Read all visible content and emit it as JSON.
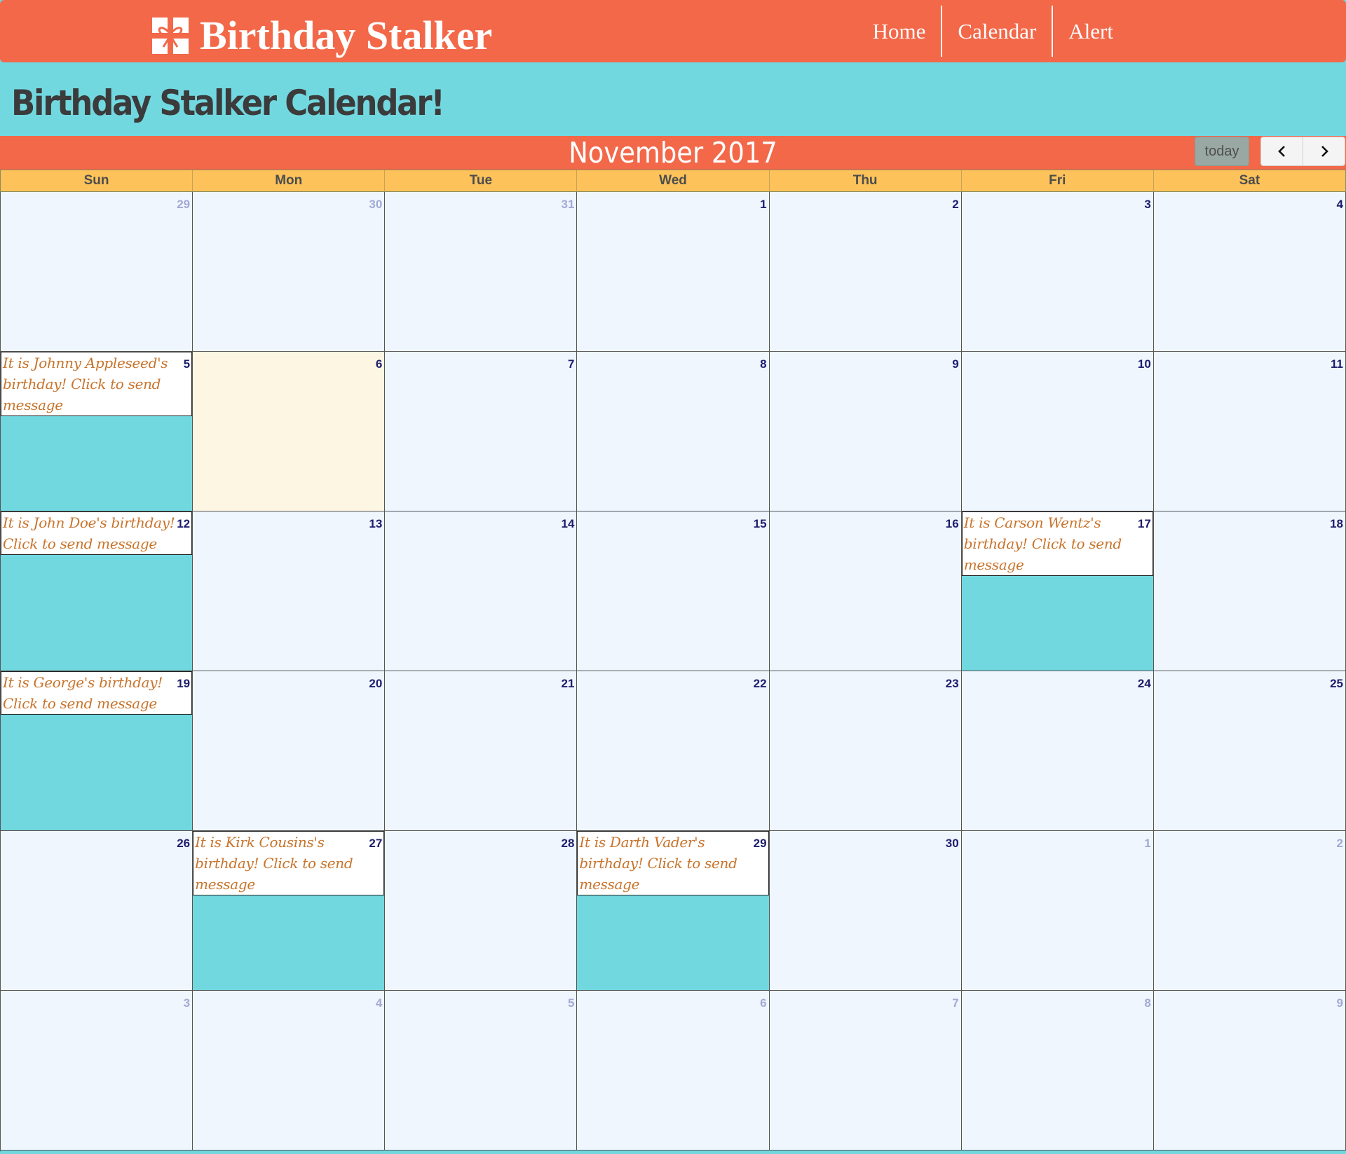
{
  "nav": {
    "brand": "Birthday Stalker",
    "links": [
      "Home",
      "Calendar",
      "Alert"
    ]
  },
  "page_title": "Birthday Stalker Calendar!",
  "calendar": {
    "month_title": "November 2017",
    "today_label": "today",
    "weekdays": [
      "Sun",
      "Mon",
      "Tue",
      "Wed",
      "Thu",
      "Fri",
      "Sat"
    ],
    "days": [
      {
        "n": "29",
        "other": true
      },
      {
        "n": "30",
        "other": true
      },
      {
        "n": "31",
        "other": true
      },
      {
        "n": "1"
      },
      {
        "n": "2"
      },
      {
        "n": "3"
      },
      {
        "n": "4"
      },
      {
        "n": "5",
        "event": "It is Johnny Appleseed's birthday! Click to send message",
        "lines": 3
      },
      {
        "n": "6",
        "today": true
      },
      {
        "n": "7"
      },
      {
        "n": "8"
      },
      {
        "n": "9"
      },
      {
        "n": "10"
      },
      {
        "n": "11"
      },
      {
        "n": "12",
        "event": "It is John Doe's birthday! Click to send message",
        "lines": 2
      },
      {
        "n": "13"
      },
      {
        "n": "14"
      },
      {
        "n": "15"
      },
      {
        "n": "16"
      },
      {
        "n": "17",
        "event": "It is Carson Wentz's birthday! Click to send message",
        "lines": 3
      },
      {
        "n": "18"
      },
      {
        "n": "19",
        "event": "It is George's birthday! Click to send message",
        "lines": 2
      },
      {
        "n": "20"
      },
      {
        "n": "21"
      },
      {
        "n": "22"
      },
      {
        "n": "23"
      },
      {
        "n": "24"
      },
      {
        "n": "25"
      },
      {
        "n": "26"
      },
      {
        "n": "27",
        "event": "It is Kirk Cousins's birthday! Click to send message",
        "lines": 3
      },
      {
        "n": "28"
      },
      {
        "n": "29",
        "event": "It is Darth Vader's birthday! Click to send message",
        "lines": 3
      },
      {
        "n": "30"
      },
      {
        "n": "1",
        "other": true
      },
      {
        "n": "2",
        "other": true
      },
      {
        "n": "3",
        "other": true
      },
      {
        "n": "4",
        "other": true
      },
      {
        "n": "5",
        "other": true
      },
      {
        "n": "6",
        "other": true
      },
      {
        "n": "7",
        "other": true
      },
      {
        "n": "8",
        "other": true
      },
      {
        "n": "9",
        "other": true
      }
    ]
  }
}
